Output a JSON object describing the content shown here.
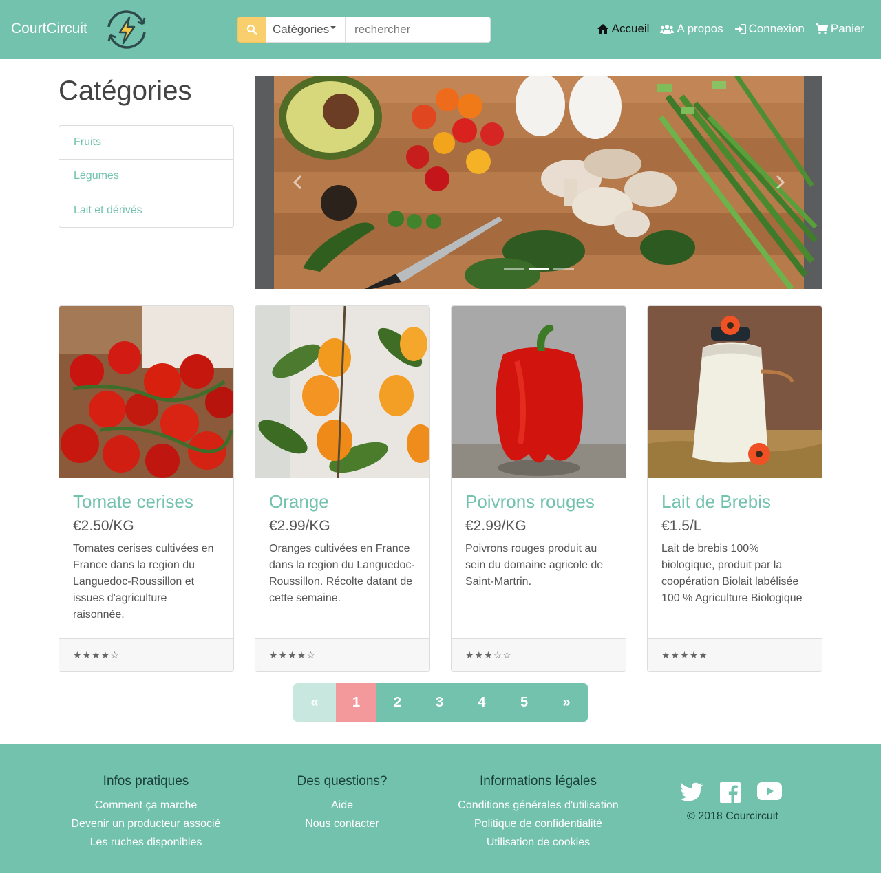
{
  "navbar": {
    "brand": "CourtCircuit",
    "category_select": "Catégories",
    "search_placeholder": "rechercher",
    "links": [
      {
        "label": "Accueil",
        "icon": "home-icon"
      },
      {
        "label": "A propos",
        "icon": "users-icon"
      },
      {
        "label": "Connexion",
        "icon": "sign-in-icon"
      },
      {
        "label": "Panier",
        "icon": "cart-icon"
      }
    ]
  },
  "sidebar": {
    "title": "Catégories",
    "items": [
      {
        "label": "Fruits"
      },
      {
        "label": "Légumes"
      },
      {
        "label": "Lait et dérivés"
      }
    ]
  },
  "carousel": {
    "slides": 3,
    "active_slide": 2
  },
  "products": [
    {
      "name": "Tomate cerises",
      "price": "€2.50/KG",
      "description": "Tomates cerises cultivées en France dans la region du Languedoc-Roussillon et issues d'agriculture raisonnée.",
      "rating_stars": "★★★★☆",
      "rating": 4
    },
    {
      "name": "Orange",
      "price": "€2.99/KG",
      "description": "Oranges cultivées en France dans la region du Languedoc-Roussillon. Récolte datant de cette semaine.",
      "rating_stars": "★★★★☆",
      "rating": 4
    },
    {
      "name": "Poivrons rouges",
      "price": "€2.99/KG",
      "description": "Poivrons rouges produit au sein du domaine agricole de Saint-Martrin.",
      "rating_stars": "★★★☆☆",
      "rating": 3
    },
    {
      "name": "Lait de Brebis",
      "price": "€1.5/L",
      "description": "Lait de brebis 100% biologique, produit par la coopération Biolait labélisée 100 % Agriculture Biologique",
      "rating_stars": "★★★★★",
      "rating": 5
    }
  ],
  "pagination": {
    "prev": "«",
    "next": "»",
    "pages": [
      "1",
      "2",
      "3",
      "4",
      "5"
    ],
    "current": "1"
  },
  "footer": {
    "col1": {
      "title": "Infos pratiques",
      "links": [
        "Comment ça marche",
        "Devenir un producteur associé",
        "Les ruches disponibles"
      ]
    },
    "col2": {
      "title": "Des questions?",
      "links": [
        "Aide",
        "Nous contacter"
      ]
    },
    "col3": {
      "title": "Informations légales",
      "links": [
        "Conditions générales d'utilisation",
        "Politique de confidentialité",
        "Utilisation de cookies"
      ]
    },
    "social": [
      "twitter-icon",
      "facebook-icon",
      "youtube-icon"
    ],
    "copyright": "© 2018 Courcircuit"
  },
  "colors": {
    "primary": "#73c2ad",
    "accent": "#f9cf6e",
    "active_page": "#f4999b",
    "footer_heading": "#1a3f3a"
  }
}
